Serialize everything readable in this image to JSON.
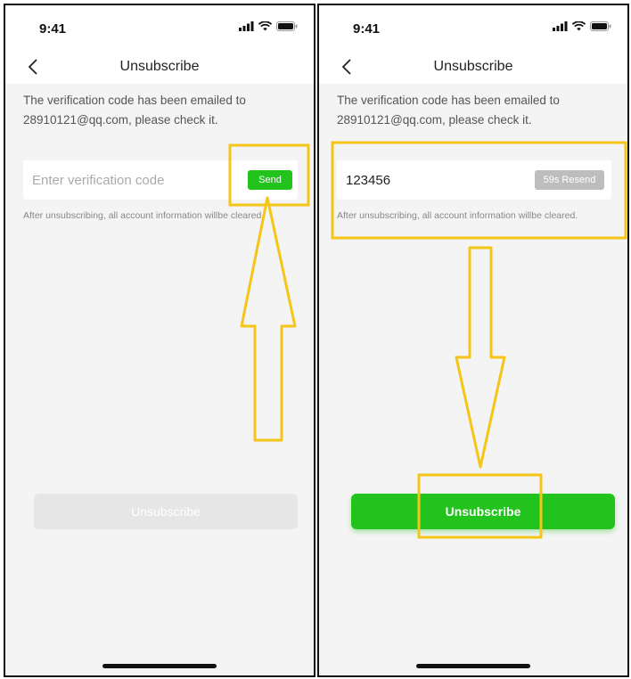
{
  "status": {
    "time": "9:41"
  },
  "left": {
    "title": "Unsubscribe",
    "info": "The verification code has been emailed to 28910121@qq.com, please check it.",
    "input_placeholder": "Enter verification code",
    "input_value": "",
    "send_label": "Send",
    "note": "After unsubscribing, all account information willbe cleared.",
    "unsubscribe_label": "Unsubscribe",
    "unsubscribe_enabled": false
  },
  "right": {
    "title": "Unsubscribe",
    "info": "The verification code has been emailed to 28910121@qq.com, please check it.",
    "input_value": "123456",
    "resend_label": "59s Resend",
    "note": "After unsubscribing, all account information willbe cleared.",
    "unsubscribe_label": "Unsubscribe",
    "unsubscribe_enabled": true
  },
  "colors": {
    "accent_green": "#23c31e",
    "highlight_yellow": "#f5c518",
    "disabled_gray": "#e6e6e6",
    "resend_gray": "#bdbdbd"
  },
  "icons": [
    "back-icon",
    "signal-icon",
    "wifi-icon",
    "battery-icon",
    "arrow-up-annotation",
    "arrow-down-annotation"
  ]
}
